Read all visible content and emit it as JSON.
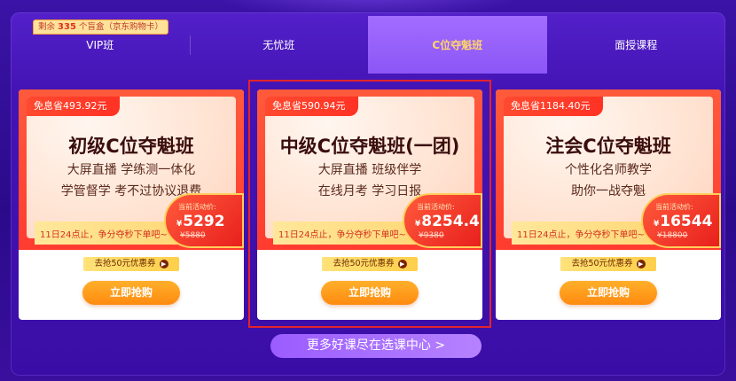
{
  "tabs": [
    {
      "label": "VIP班"
    },
    {
      "label": "无忧班"
    },
    {
      "label": "C位夺魁班"
    },
    {
      "label": "面授课程"
    }
  ],
  "stock_badge": {
    "prefix": "剩余",
    "count": "335",
    "suffix": "个盲盒（京东购物卡）"
  },
  "cards": [
    {
      "tag": "免息省493.92元",
      "title": "初级C位夺魁班",
      "line1": "大屏直播 学练测一体化",
      "line2": "学管督学 考不过协议退费",
      "strip": "11日24点止，争分夺秒下单吧~",
      "price_label": "当前活动价:",
      "price_currency": "¥",
      "price": "5292",
      "original": "¥5880",
      "coupon": "去抢50元优惠券",
      "buy": "立即抢购"
    },
    {
      "tag": "免息省590.94元",
      "title": "中级C位夺魁班(一团)",
      "line1": "大屏直播 班级伴学",
      "line2": "在线月考 学习日报",
      "strip": "11日24点止，争分夺秒下单吧~",
      "price_label": "当前活动价:",
      "price_currency": "¥",
      "price": "8254.4",
      "original": "¥9380",
      "coupon": "去抢50元优惠券",
      "buy": "立即抢购"
    },
    {
      "tag": "免息省1184.40元",
      "title": "注会C位夺魁班",
      "line1": "个性化名师教学",
      "line2": "助你一战夺魁",
      "strip": "11日24点止，争分夺秒下单吧~",
      "price_label": "当前活动价:",
      "price_currency": "¥",
      "price": "16544",
      "original": "¥18800",
      "coupon": "去抢50元优惠券",
      "buy": "立即抢购"
    }
  ],
  "more_link": "更多好课尽在选课中心 >",
  "colors": {
    "accent": "#ff3b2f",
    "tab_active": "#a36cff",
    "gold": "#ffd46a",
    "background": "#3b13a6"
  }
}
